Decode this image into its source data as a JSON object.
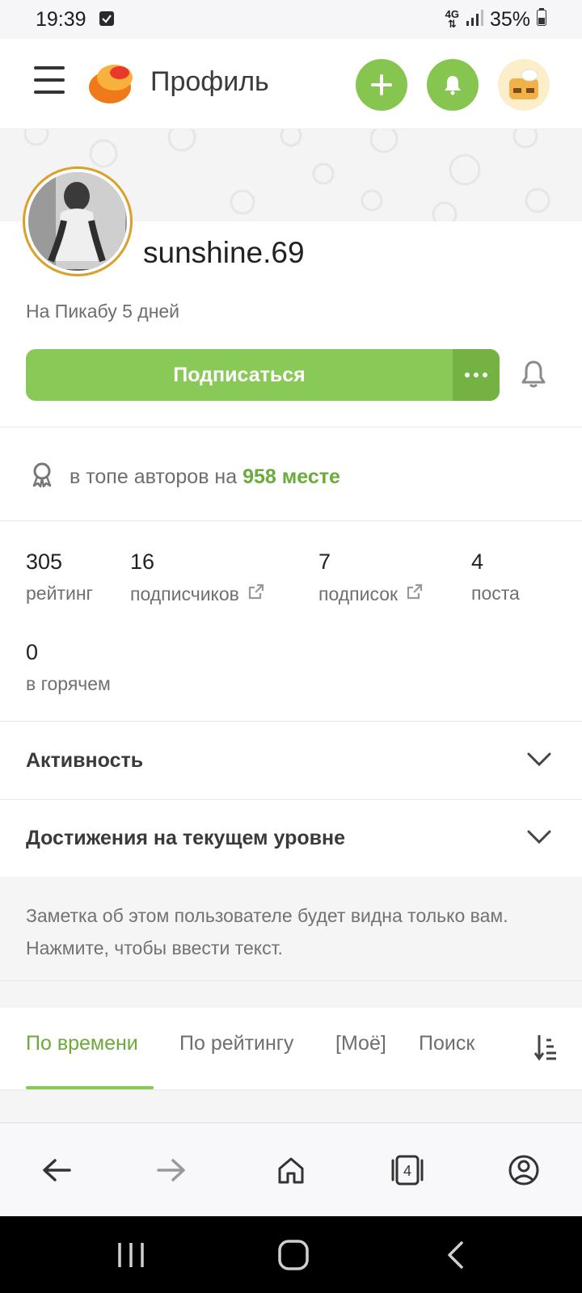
{
  "status": {
    "time": "19:39",
    "net_top": "4G",
    "battery": "35%"
  },
  "header": {
    "title": "Профиль"
  },
  "profile": {
    "username": "sunshine.69",
    "since": "На Пикабу 5 дней",
    "subscribe_label": "Подписаться",
    "more_label": "···"
  },
  "top_authors": {
    "prefix": "в топе авторов на",
    "place": "958 месте"
  },
  "stats": [
    {
      "value": "305",
      "label": "рейтинг"
    },
    {
      "value": "16",
      "label": "подписчиков"
    },
    {
      "value": "7",
      "label": "подписок"
    },
    {
      "value": "4",
      "label": "поста"
    },
    {
      "value": "0",
      "label": "в горячем"
    }
  ],
  "sections": {
    "activity": "Активность",
    "achievements": "Достижения на текущем уровне"
  },
  "note": {
    "text": "Заметка об этом пользователе будет видна только вам. Нажмите, чтобы ввести текст."
  },
  "tabs": [
    {
      "label": "По времени",
      "active": true
    },
    {
      "label": "По рейтингу"
    },
    {
      "label": "[Моё]"
    },
    {
      "label": "Поиск"
    }
  ],
  "browser": {
    "tab_count": "4"
  },
  "colors": {
    "accent": "#88c957",
    "accent_text": "#6aab3a",
    "avatar_ring": "#d9a02a"
  }
}
